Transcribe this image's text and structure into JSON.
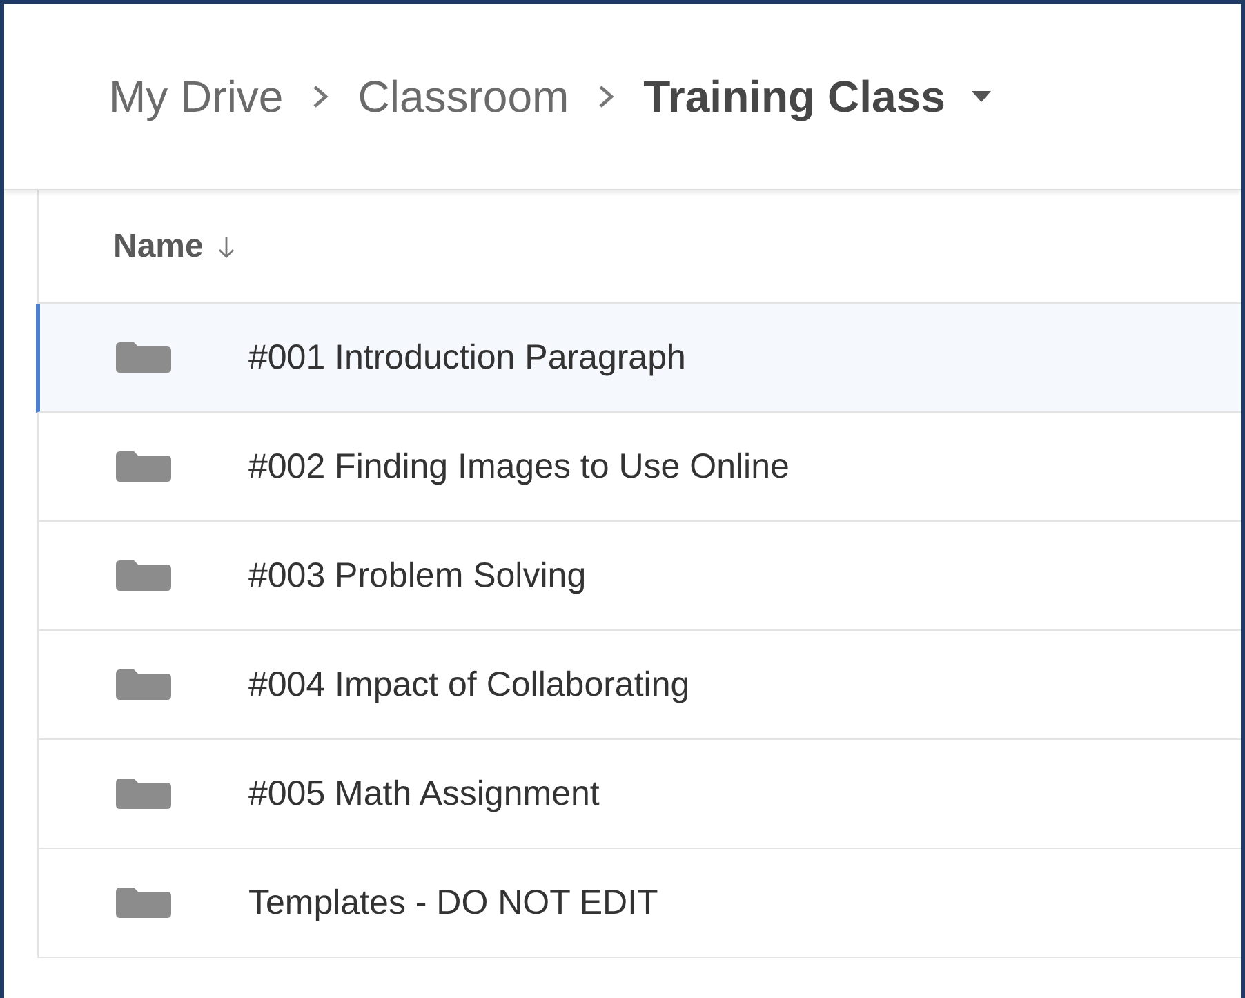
{
  "breadcrumb": [
    {
      "label": "My Drive",
      "current": false
    },
    {
      "label": "Classroom",
      "current": false
    },
    {
      "label": "Training Class",
      "current": true
    }
  ],
  "list": {
    "column": {
      "label": "Name",
      "descending": true
    },
    "rows": [
      {
        "name": "#001 Introduction Paragraph",
        "selected": true
      },
      {
        "name": "#002 Finding Images to Use Online",
        "selected": false
      },
      {
        "name": "#003 Problem Solving",
        "selected": false
      },
      {
        "name": "#004 Impact of Collaborating",
        "selected": false
      },
      {
        "name": "#005 Math Assignment",
        "selected": false
      },
      {
        "name": "Templates - DO NOT EDIT",
        "selected": false
      }
    ]
  }
}
